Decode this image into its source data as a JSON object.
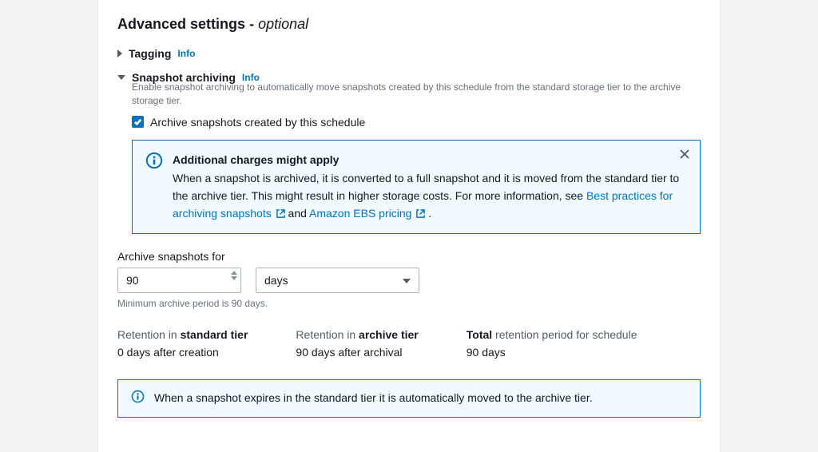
{
  "section": {
    "title": "Advanced settings",
    "optional": "optional"
  },
  "tagging": {
    "label": "Tagging",
    "info": "Info"
  },
  "archiving": {
    "label": "Snapshot archiving",
    "info": "Info",
    "description": "Enable snapshot archiving to automatically move snapshots created by this schedule from the standard storage tier to the archive storage tier.",
    "checkbox_label": "Archive snapshots created by this schedule"
  },
  "alert1": {
    "title": "Additional charges might apply",
    "body_before": "When a snapshot is archived, it is converted to a full snapshot and it is moved from the standard tier to the archive tier. This might result in higher storage costs. For more information, see ",
    "link1": "Best practices for archiving snapshots",
    "middle": " and ",
    "link2": "Amazon EBS pricing",
    "end": "."
  },
  "archive_for": {
    "label": "Archive snapshots for",
    "value": "90",
    "unit": "days",
    "hint": "Minimum archive period is 90 days."
  },
  "retention": {
    "standard": {
      "prefix": "Retention in ",
      "bold": "standard tier",
      "value": "0 days after creation"
    },
    "archive": {
      "prefix": "Retention in ",
      "bold": "archive tier",
      "value": "90 days after archival"
    },
    "total": {
      "bold": "Total",
      "suffix": " retention period for schedule",
      "value": "90 days"
    }
  },
  "alert2": {
    "text": "When a snapshot expires in the standard tier it is automatically moved to the archive tier."
  }
}
